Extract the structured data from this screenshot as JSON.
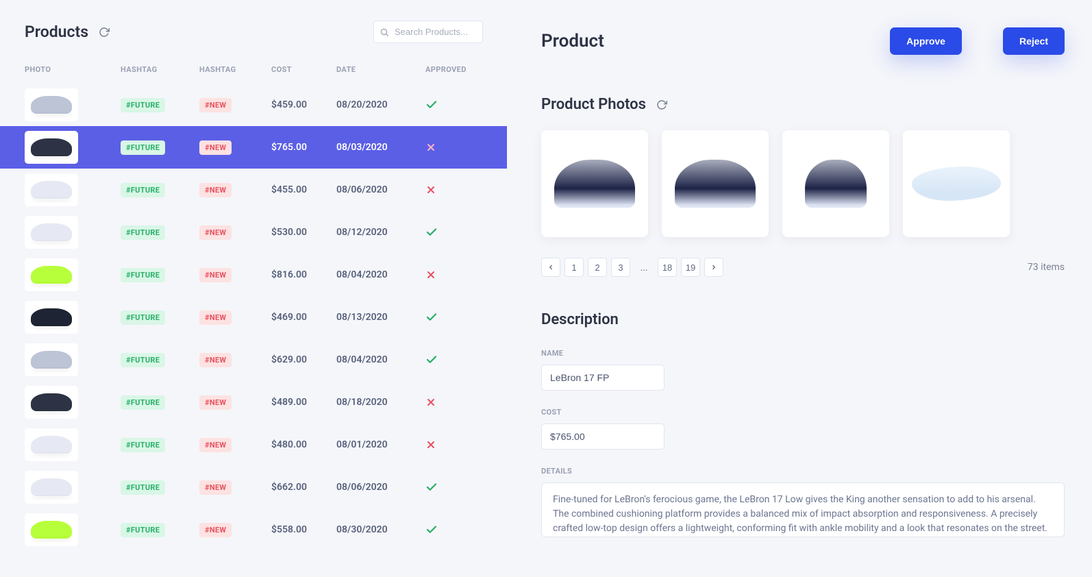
{
  "left": {
    "title": "Products",
    "search_placeholder": "Search Products...",
    "columns": {
      "photo": "PHOTO",
      "hashtag1": "HASHTAG",
      "hashtag2": "HASHTAG",
      "cost": "COST",
      "date": "DATE",
      "approved": "APPROVED"
    },
    "tag_future": "#FUTURE",
    "tag_new": "#NEW",
    "rows": [
      {
        "cost": "$459.00",
        "date": "08/20/2020",
        "approved": true,
        "selected": false,
        "shoe": "#bcc4d6"
      },
      {
        "cost": "$765.00",
        "date": "08/03/2020",
        "approved": false,
        "selected": true,
        "shoe": "#2d3344"
      },
      {
        "cost": "$455.00",
        "date": "08/06/2020",
        "approved": false,
        "selected": false,
        "shoe": "#e6e9f3"
      },
      {
        "cost": "$530.00",
        "date": "08/12/2020",
        "approved": true,
        "selected": false,
        "shoe": "#e6e9f3"
      },
      {
        "cost": "$816.00",
        "date": "08/04/2020",
        "approved": false,
        "selected": false,
        "shoe": "#b7ff3a"
      },
      {
        "cost": "$469.00",
        "date": "08/13/2020",
        "approved": true,
        "selected": false,
        "shoe": "#1f2434"
      },
      {
        "cost": "$629.00",
        "date": "08/04/2020",
        "approved": true,
        "selected": false,
        "shoe": "#bcc4d6"
      },
      {
        "cost": "$489.00",
        "date": "08/18/2020",
        "approved": false,
        "selected": false,
        "shoe": "#2d3344"
      },
      {
        "cost": "$480.00",
        "date": "08/01/2020",
        "approved": false,
        "selected": false,
        "shoe": "#e6e9f3"
      },
      {
        "cost": "$662.00",
        "date": "08/06/2020",
        "approved": true,
        "selected": false,
        "shoe": "#e6e9f3"
      },
      {
        "cost": "$558.00",
        "date": "08/30/2020",
        "approved": true,
        "selected": false,
        "shoe": "#b7ff3a"
      }
    ]
  },
  "right": {
    "title": "Product",
    "approve_label": "Approve",
    "reject_label": "Reject",
    "photos_title": "Product Photos",
    "pagination": {
      "pages": [
        "1",
        "2",
        "3",
        "...",
        "18",
        "19"
      ],
      "total": "73 items"
    },
    "description": {
      "title": "Description",
      "name_label": "NAME",
      "name_value": "LeBron 17 FP",
      "cost_label": "COST",
      "cost_value": "$765.00",
      "details_label": "DETAILS",
      "details_value": "Fine-tuned for LeBron's ferocious game, the LeBron 17 Low gives the King another sensation to add to his arsenal. The combined cushioning platform provides a balanced mix of impact absorption and responsiveness. A precisely crafted low-top design offers a lightweight, conforming fit with ankle mobility and a look that resonates on the street."
    }
  }
}
